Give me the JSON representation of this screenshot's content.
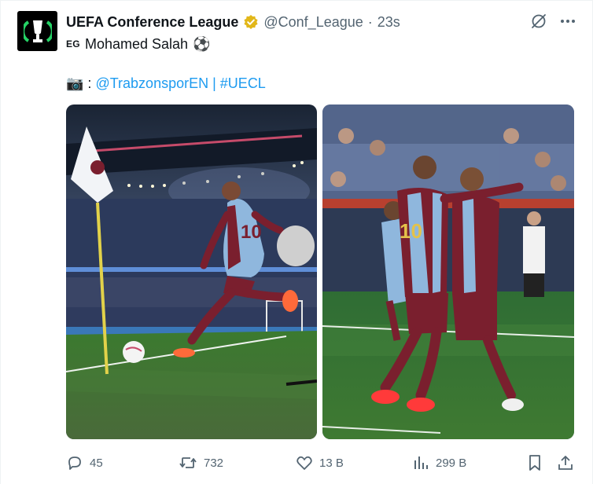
{
  "tweet": {
    "author": {
      "display_name": "UEFA Conference League",
      "verified": true,
      "handle": "@Conf_League",
      "separator": "·",
      "time": "23s",
      "avatar_icon": "uefa-conference-league-logo"
    },
    "translate_label": "EG",
    "subtitle_text": "Mohamed Salah",
    "subtitle_emoji": "⚽",
    "text": {
      "camera_emoji": "📷",
      "colon": ":",
      "mention": "@TrabzonsporEN",
      "pipe": "|",
      "hashtag": "#UECL"
    },
    "media": [
      {
        "icon": "photo",
        "subject": "player-taking-corner-kick"
      },
      {
        "icon": "photo",
        "subject": "players-celebrating-goal"
      }
    ],
    "stats": {
      "replies": "45",
      "reposts": "732",
      "likes": "13 B",
      "views": "299 B"
    },
    "colors": {
      "link": "#1d9bf0",
      "secondary_text": "#536471",
      "verified_gold": "#e2b719",
      "jersey_maroon": "#7a1f2e",
      "jersey_blue": "#8fb7dd",
      "pitch_green": "#3f7a32"
    }
  }
}
